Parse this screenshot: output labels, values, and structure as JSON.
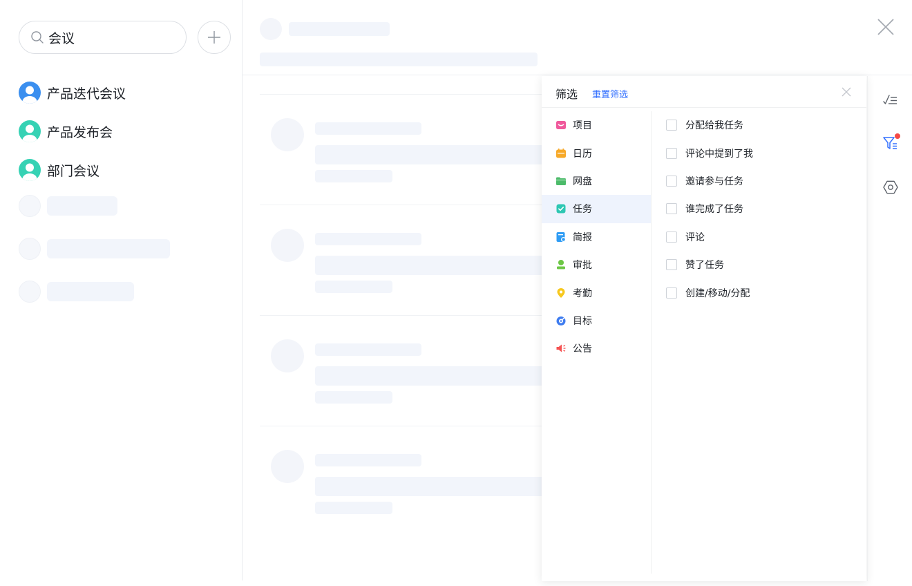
{
  "search": {
    "query": "会议"
  },
  "results": [
    {
      "label": "产品迭代会议",
      "avatar_color": "#3b8fef"
    },
    {
      "label": "产品发布会",
      "avatar_color": "#36d2b4"
    },
    {
      "label": "部门会议",
      "avatar_color": "#36d2b4"
    }
  ],
  "filter": {
    "title": "筛选",
    "reset_label": "重置筛选",
    "categories": [
      {
        "label": "项目",
        "icon": "project-icon",
        "color": "#f0599c"
      },
      {
        "label": "日历",
        "icon": "calendar-icon",
        "color": "#f7a928"
      },
      {
        "label": "网盘",
        "icon": "folder-icon",
        "color": "#4cbb6a"
      },
      {
        "label": "任务",
        "icon": "task-icon",
        "color": "#2ec7b3",
        "active": true
      },
      {
        "label": "简报",
        "icon": "report-icon",
        "color": "#2f9cf4"
      },
      {
        "label": "审批",
        "icon": "approval-icon",
        "color": "#6cc644"
      },
      {
        "label": "考勤",
        "icon": "attendance-icon",
        "color": "#f7c81e"
      },
      {
        "label": "目标",
        "icon": "target-icon",
        "color": "#3e7cf0"
      },
      {
        "label": "公告",
        "icon": "announcement-icon",
        "color": "#f55353"
      }
    ],
    "options": [
      {
        "label": "分配给我任务",
        "checked": false
      },
      {
        "label": "评论中提到了我",
        "checked": false
      },
      {
        "label": "邀请参与任务",
        "checked": false
      },
      {
        "label": "谁完成了任务",
        "checked": false
      },
      {
        "label": "评论",
        "checked": false
      },
      {
        "label": "赞了任务",
        "checked": false
      },
      {
        "label": "创建/移动/分配",
        "checked": false
      }
    ]
  },
  "colors": {
    "accent": "#3370ff",
    "notification": "#f54a45",
    "skeleton": "#f2f5fb"
  }
}
